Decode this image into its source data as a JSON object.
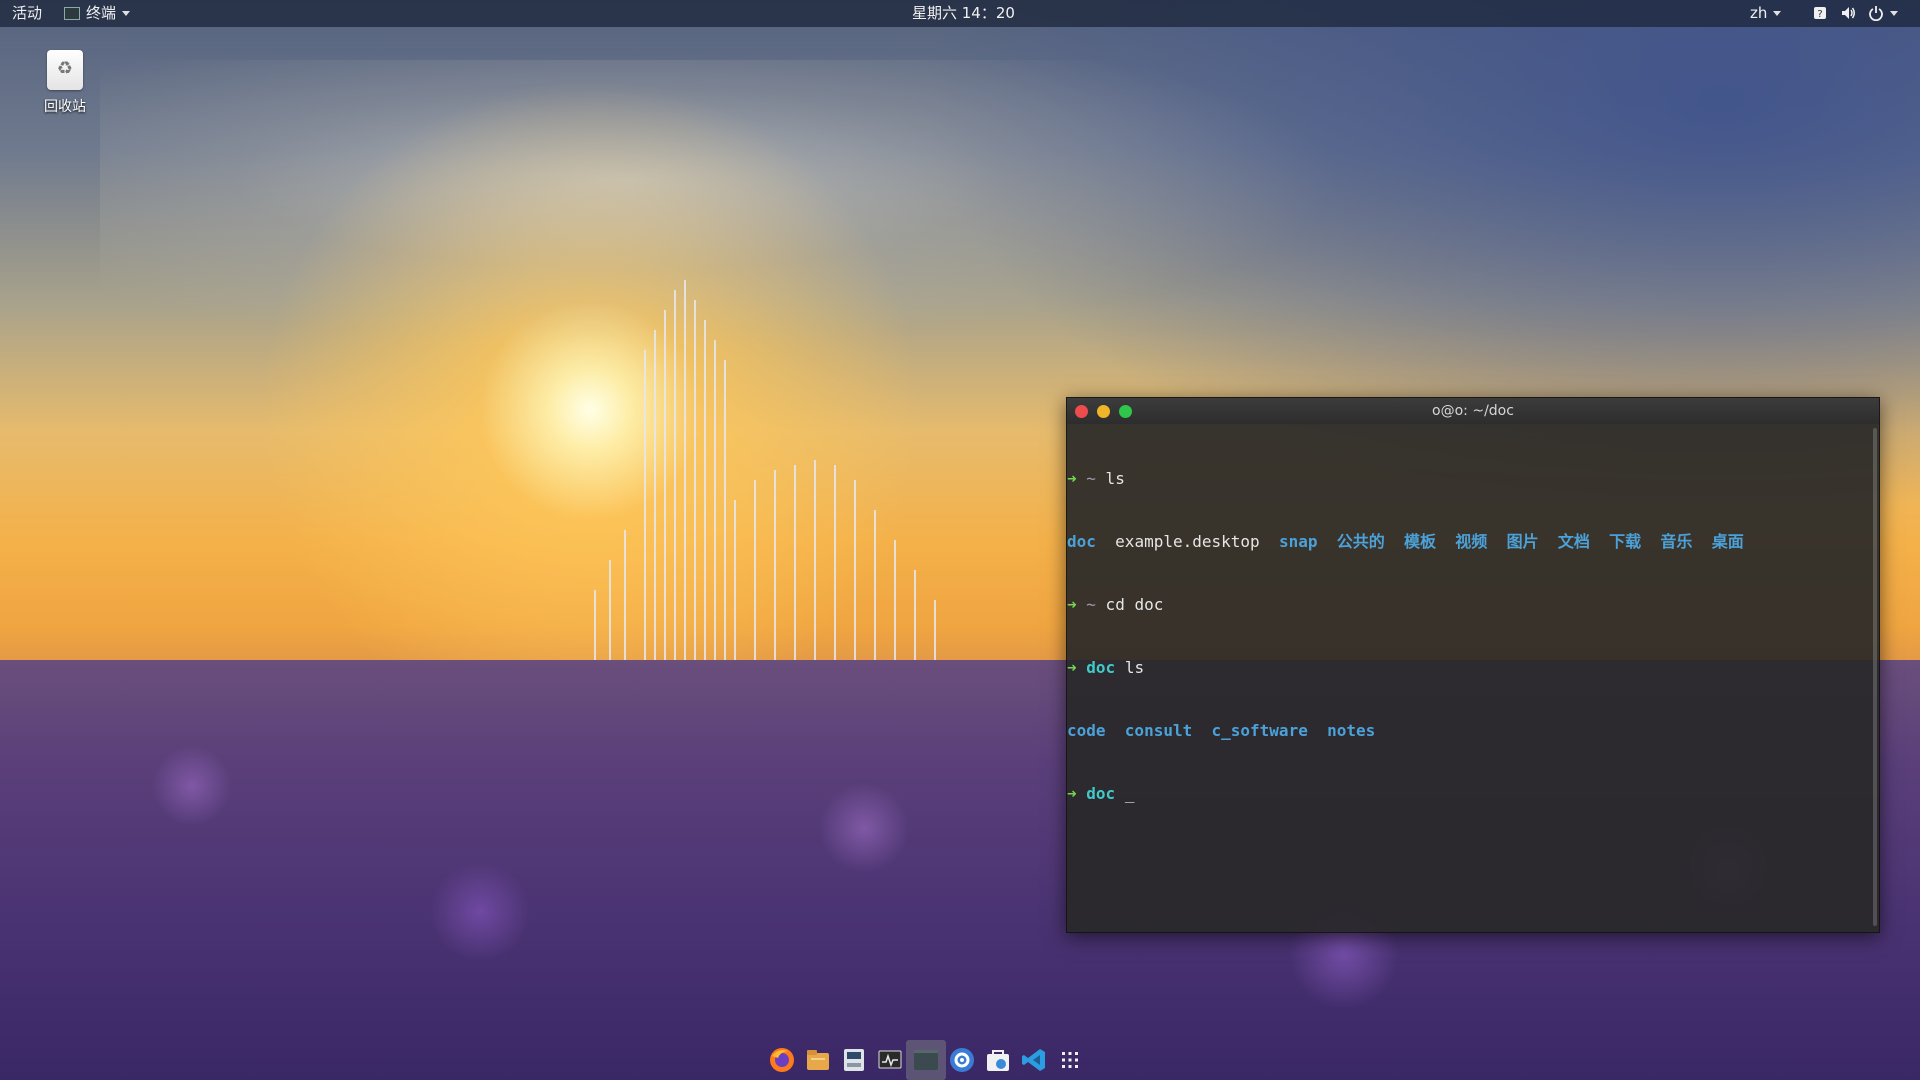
{
  "topbar": {
    "activities": "活动",
    "app_menu": "终端",
    "clock": "星期六 14：20",
    "input_method": "zh"
  },
  "desktop": {
    "trash_label": "回收站"
  },
  "terminal": {
    "title": "o@o: ~/doc",
    "lines": [
      {
        "arrow": "➜",
        "path": "~",
        "command": " ls"
      },
      {
        "items": [
          "doc",
          "example.desktop",
          "snap",
          "公共的",
          "模板",
          "视频",
          "图片",
          "文档",
          "下载",
          "音乐",
          "桌面"
        ]
      },
      {
        "arrow": "➜",
        "path": "~",
        "command": " cd doc"
      },
      {
        "arrow": "➜",
        "path": "doc",
        "command": " ls"
      },
      {
        "items": [
          "code",
          "consult",
          "c_software",
          "notes"
        ]
      },
      {
        "arrow": "➜",
        "path": "doc",
        "command": " _"
      }
    ]
  },
  "dock": {
    "items": [
      "firefox-icon",
      "files-icon",
      "disk-icon",
      "system-monitor-icon",
      "terminal-icon",
      "settings-icon",
      "software-store-icon",
      "vscode-icon",
      "app-grid-icon"
    ]
  },
  "colors": {
    "prompt_arrow": "#77d64f",
    "directory": "#4ba1d8",
    "cwd": "#41c9c9",
    "close": "#ee4c4c",
    "minimize": "#f0b428",
    "maximize": "#2ec74b"
  }
}
